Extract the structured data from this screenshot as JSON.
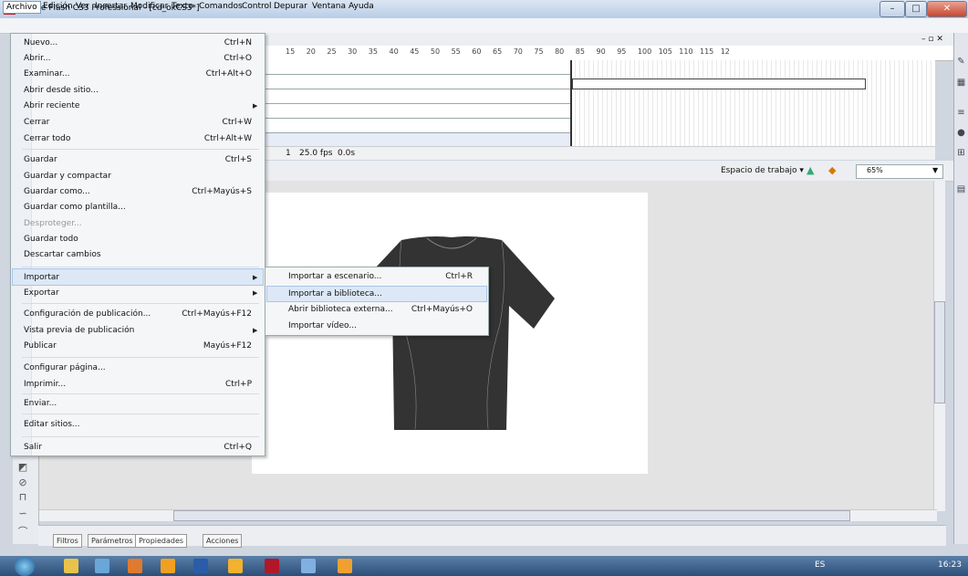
{
  "window": {
    "title": "Adobe Flash CS3 Professional - [cd_okCS3*]",
    "app_icon_text": "Fl"
  },
  "menubar": [
    "Archivo",
    "Edición",
    "Ver",
    "Insertar",
    "Modificar",
    "Texto",
    "Comandos",
    "Control",
    "Depurar",
    "Ventana",
    "Ayuda"
  ],
  "archivo_menu": [
    {
      "label": "Nuevo...",
      "shortcut": "Ctrl+N"
    },
    {
      "label": "Abrir...",
      "shortcut": "Ctrl+O"
    },
    {
      "label": "Examinar...",
      "shortcut": "Ctrl+Alt+O"
    },
    {
      "label": "Abrir desde sitio...",
      "shortcut": ""
    },
    {
      "label": "Abrir reciente",
      "shortcut": "",
      "submenu": true
    },
    {
      "label": "Cerrar",
      "shortcut": "Ctrl+W"
    },
    {
      "label": "Cerrar todo",
      "shortcut": "Ctrl+Alt+W"
    },
    {
      "label": "Guardar",
      "shortcut": "Ctrl+S"
    },
    {
      "label": "Guardar y compactar",
      "shortcut": ""
    },
    {
      "label": "Guardar como...",
      "shortcut": "Ctrl+Mayús+S"
    },
    {
      "label": "Guardar como plantilla...",
      "shortcut": ""
    },
    {
      "label": "Desproteger...",
      "shortcut": "",
      "disabled": true
    },
    {
      "label": "Guardar todo",
      "shortcut": ""
    },
    {
      "label": "Descartar cambios",
      "shortcut": ""
    },
    {
      "label": "Importar",
      "shortcut": "",
      "submenu": true,
      "highlighted": true
    },
    {
      "label": "Exportar",
      "shortcut": "",
      "submenu": true
    },
    {
      "label": "Configuración de publicación...",
      "shortcut": "Ctrl+Mayús+F12"
    },
    {
      "label": "Vista previa de publicación",
      "shortcut": "",
      "submenu": true
    },
    {
      "label": "Publicar",
      "shortcut": "Mayús+F12"
    },
    {
      "label": "Configurar página...",
      "shortcut": ""
    },
    {
      "label": "Imprimir...",
      "shortcut": "Ctrl+P"
    },
    {
      "label": "Enviar...",
      "shortcut": ""
    },
    {
      "label": "Editar sitios...",
      "shortcut": ""
    },
    {
      "label": "Salir",
      "shortcut": "Ctrl+Q"
    }
  ],
  "importar_submenu": [
    {
      "label": "Importar a escenario...",
      "shortcut": "Ctrl+R"
    },
    {
      "label": "Importar a biblioteca...",
      "shortcut": "",
      "highlighted": true
    },
    {
      "label": "Abrir biblioteca externa...",
      "shortcut": "Ctrl+Mayús+O"
    },
    {
      "label": "Importar vídeo...",
      "shortcut": ""
    }
  ],
  "timeline": {
    "ruler": [
      "15",
      "20",
      "25",
      "30",
      "35",
      "40",
      "45",
      "50",
      "55",
      "60",
      "65",
      "70",
      "75",
      "80",
      "85",
      "90",
      "95",
      "100",
      "105",
      "110",
      "115",
      "12"
    ],
    "current_frame": "1",
    "fps": "25.0 fps",
    "time": "0.0s"
  },
  "editbar": {
    "workspace_label": "Espacio de trabajo ▾",
    "zoom": "65%"
  },
  "properties_tabs": [
    "Filtros",
    "Parámetros",
    "Propiedades",
    "Acciones"
  ],
  "taskbar": {
    "lang": "ES",
    "clock": "16:23"
  },
  "colors": {
    "shirt": "#333333",
    "menu_highlight": "#dce8f6",
    "stage": "#ffffff"
  }
}
